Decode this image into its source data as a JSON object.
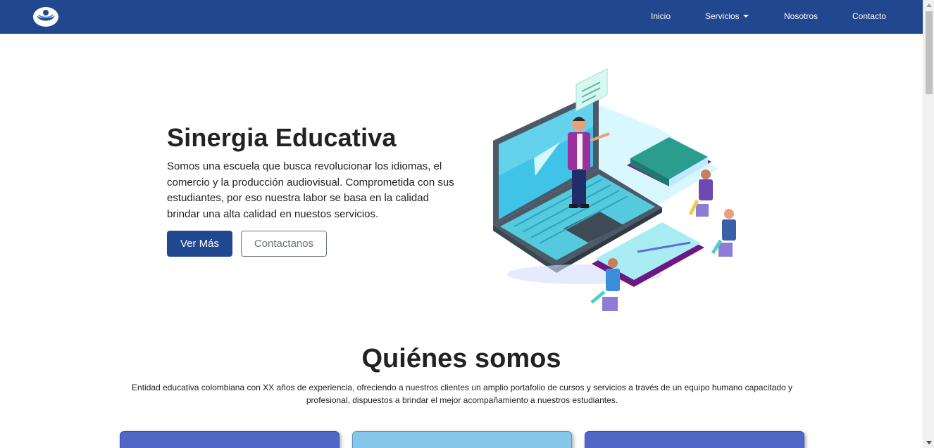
{
  "nav": {
    "inicio": "Inicio",
    "servicios": "Servicios",
    "nosotros": "Nosotros",
    "contacto": "Contacto"
  },
  "hero": {
    "title": "Sinergia Educativa",
    "description": "Somos una escuela que busca revolucionar los idiomas, el comercio y la producción audiovisual. Comprometida con sus estudiantes, por eso nuestra labor se basa en la calidad brindar una alta calidad en nuestos servicios.",
    "primary_button": "Ver Más",
    "secondary_button": "Contactanos"
  },
  "about": {
    "title": "Quiénes somos",
    "description": "Entidad educativa colombiana con XX años de experiencia, ofreciendo a nuestros clientes un amplio portafolio de cursos y servicios a través de un equipo humano capacitado y profesional, dispuestos a brindar el mejor acompañamiento a nuestros estudiantes."
  },
  "colors": {
    "brand": "#21478f",
    "card_blue": "#5067c8",
    "card_light": "#85c6ea"
  }
}
